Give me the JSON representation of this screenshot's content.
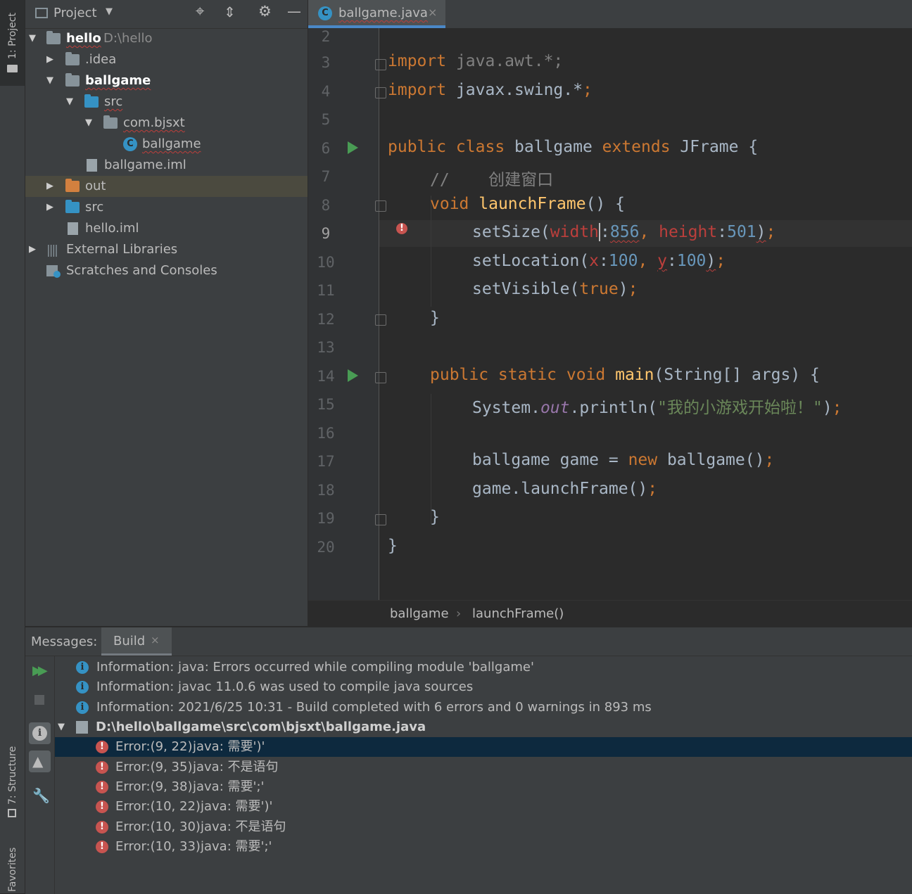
{
  "sidebar": {
    "project_tab": "1: Project",
    "structure_tab": "7: Structure",
    "favorites_tab": "Favorites"
  },
  "project": {
    "title": "Project",
    "tree": [
      {
        "label": "hello",
        "hint": "D:\\hello"
      },
      {
        "label": ".idea"
      },
      {
        "label": "ballgame"
      },
      {
        "label": "src"
      },
      {
        "label": "com.bjsxt"
      },
      {
        "label": "ballgame"
      },
      {
        "label": "ballgame.iml"
      },
      {
        "label": "out"
      },
      {
        "label": "src"
      },
      {
        "label": "hello.iml"
      },
      {
        "label": "External Libraries"
      },
      {
        "label": "Scratches and Consoles"
      }
    ]
  },
  "editor": {
    "tab_label": "ballgame.java",
    "line_numbers": [
      "2",
      "3",
      "4",
      "5",
      "6",
      "7",
      "8",
      "9",
      "10",
      "11",
      "12",
      "13",
      "14",
      "15",
      "16",
      "17",
      "18",
      "19",
      "20"
    ],
    "current_line": "9",
    "breadcrumb": [
      "ballgame",
      "launchFrame()"
    ],
    "code": {
      "l3": [
        "import",
        " java.awt.*;"
      ],
      "l4": [
        "import",
        " javax.swing.*",
        ";"
      ],
      "l6": [
        "public class ",
        "ballgame ",
        "extends ",
        "JFrame {"
      ],
      "l7": [
        "//    创建窗口"
      ],
      "l8": [
        "void ",
        "launchFrame",
        "() {"
      ],
      "l9": [
        "setSize(",
        "width",
        ":",
        "856",
        ", ",
        "height",
        ":",
        "501",
        ")",
        ";"
      ],
      "l10": [
        "setLocation(",
        "x",
        ":",
        "100",
        ", ",
        "y",
        ":",
        "100",
        ")",
        ";"
      ],
      "l11": [
        "setVisible(",
        "true",
        ")",
        ";"
      ],
      "l12": [
        "}"
      ],
      "l14": [
        "public static void ",
        "main",
        "(String[] args) {"
      ],
      "l15": [
        "System.",
        "out",
        ".println(",
        "\"我的小游戏开始啦！\"",
        ")",
        ";"
      ],
      "l17": [
        "ballgame game = ",
        "new ",
        "ballgame()",
        ";"
      ],
      "l18": [
        "game.launchFrame()",
        ";"
      ],
      "l19": [
        "}"
      ],
      "l20": [
        "}"
      ]
    }
  },
  "messages": {
    "label": "Messages:",
    "tab": "Build",
    "info": [
      "Information: java: Errors occurred while compiling module 'ballgame'",
      "Information: javac 11.0.6 was used to compile java sources",
      "Information: 2021/6/25 10:31 - Build completed with 6 errors and 0 warnings in 893 ms"
    ],
    "file": "D:\\hello\\ballgame\\src\\com\\bjsxt\\ballgame.java",
    "errors": [
      {
        "loc": "Error:(9, 22)",
        "msg": "java: 需要')'"
      },
      {
        "loc": "Error:(9, 35)",
        "msg": "java: 不是语句"
      },
      {
        "loc": "Error:(9, 38)",
        "msg": "java: 需要';'"
      },
      {
        "loc": "Error:(10, 22)",
        "msg": "java: 需要')'"
      },
      {
        "loc": "Error:(10, 30)",
        "msg": "java: 不是语句"
      },
      {
        "loc": "Error:(10, 33)",
        "msg": "java: 需要';'"
      }
    ]
  },
  "icons": {
    "run": "run-gutter-icon",
    "error": "error-icon",
    "info": "info-icon"
  }
}
